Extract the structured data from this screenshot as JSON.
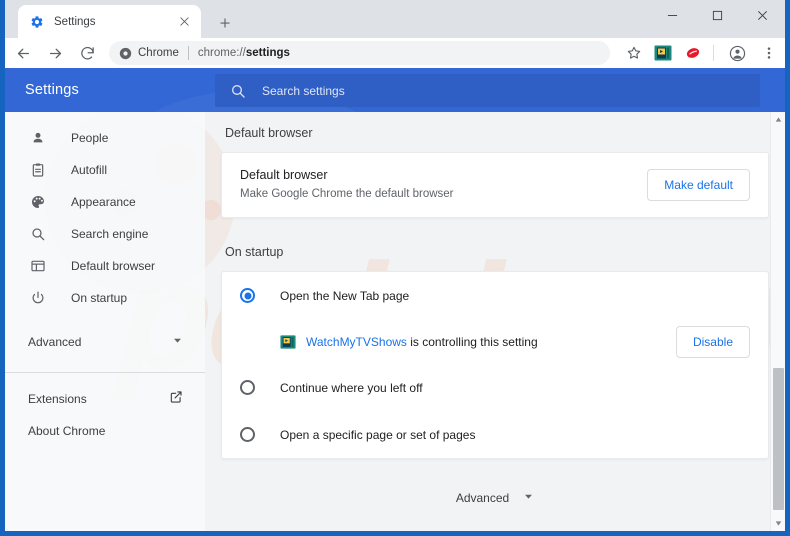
{
  "window": {
    "controls": [
      {
        "name": "minimize",
        "glyph": "minimize-icon"
      },
      {
        "name": "maximize",
        "glyph": "maximize-icon"
      },
      {
        "name": "close",
        "glyph": "close-icon"
      }
    ]
  },
  "tabstrip": {
    "tab": {
      "title": "Settings",
      "favicon": "gear-icon",
      "close_label": "×"
    },
    "new_tab_label": "+"
  },
  "toolbar": {
    "back_icon": "back-arrow-icon",
    "forward_icon": "forward-arrow-icon",
    "reload_icon": "reload-icon",
    "omnibox": {
      "chip_icon": "chrome-page-icon",
      "chip_label": "Chrome",
      "url_prefix": "chrome://",
      "url_bold": "settings"
    },
    "star_icon": "bookmark-star-icon",
    "extensions": [
      {
        "name": "watchmytvshows-extension-icon",
        "color": "#1b8a7e"
      },
      {
        "name": "red-oval-extension-icon",
        "color": "#e8192c"
      }
    ],
    "profile_icon": "profile-avatar-icon",
    "menu_icon": "three-dot-menu-icon"
  },
  "settings_header": {
    "title": "Settings",
    "search": {
      "placeholder": "Search settings",
      "icon": "search-icon",
      "value": ""
    }
  },
  "sidebar": {
    "items": [
      {
        "label": "People",
        "icon": "person-icon"
      },
      {
        "label": "Autofill",
        "icon": "clipboard-icon"
      },
      {
        "label": "Appearance",
        "icon": "palette-icon"
      },
      {
        "label": "Search engine",
        "icon": "magnifier-icon"
      },
      {
        "label": "Default browser",
        "icon": "browser-window-icon"
      },
      {
        "label": "On startup",
        "icon": "power-icon"
      }
    ],
    "advanced": {
      "label": "Advanced",
      "icon": "chevron-down-icon"
    },
    "footer_items": [
      {
        "label": "Extensions",
        "icon": "external-link-icon"
      },
      {
        "label": "About Chrome",
        "icon": ""
      }
    ]
  },
  "main": {
    "default_browser": {
      "section_title": "Default browser",
      "row_title": "Default browser",
      "row_subtitle": "Make Google Chrome the default browser",
      "button_label": "Make default"
    },
    "on_startup": {
      "section_title": "On startup",
      "options": [
        {
          "label": "Open the New Tab page",
          "checked": true
        },
        {
          "label": "Continue where you left off",
          "checked": false
        },
        {
          "label": "Open a specific page or set of pages",
          "checked": false
        }
      ],
      "controlled_notice": {
        "icon": "watchmytvshows-extension-icon",
        "extension_name": "WatchMyTVShows",
        "message": " is controlling this setting",
        "button_label": "Disable"
      }
    },
    "advanced_footer": {
      "label": "Advanced",
      "icon": "chevron-down-icon"
    }
  },
  "watermark": {
    "text": "pcrisk.com"
  },
  "colors": {
    "chrome_blue": "#1565c0",
    "settings_header": "#3367d6",
    "accent": "#1a73e8",
    "content_bg": "#f1f3f4"
  },
  "scrollbar": {
    "up_icon": "scroll-up-arrow-icon",
    "down_icon": "scroll-down-arrow-icon"
  }
}
